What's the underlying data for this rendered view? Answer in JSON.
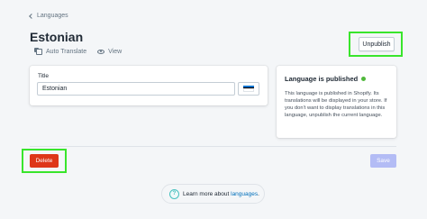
{
  "breadcrumb": {
    "label": "Languages"
  },
  "page": {
    "title": "Estonian"
  },
  "actions": {
    "auto_translate": "Auto Translate",
    "view": "View"
  },
  "header_buttons": {
    "unpublish": "Unpublish"
  },
  "form": {
    "title_label": "Title",
    "title_value": "Estonian",
    "flag_icon": "estonia-flag-icon",
    "flag_colors": [
      "#0072ce",
      "#000000",
      "#ffffff"
    ]
  },
  "status_card": {
    "title": "Language is published",
    "status_color": "#50b83c",
    "description": "This language is published in Shopify. Its translations will be displayed in your store. If you don't want to display translations in this language, unpublish the current language."
  },
  "footer_buttons": {
    "delete": "Delete",
    "save": "Save"
  },
  "help": {
    "prefix": "Learn more about",
    "link": "languages",
    "suffix": "."
  },
  "colors": {
    "highlight": "#39e52c",
    "danger": "#de3618",
    "primary_disabled": "#b3bcf5"
  }
}
